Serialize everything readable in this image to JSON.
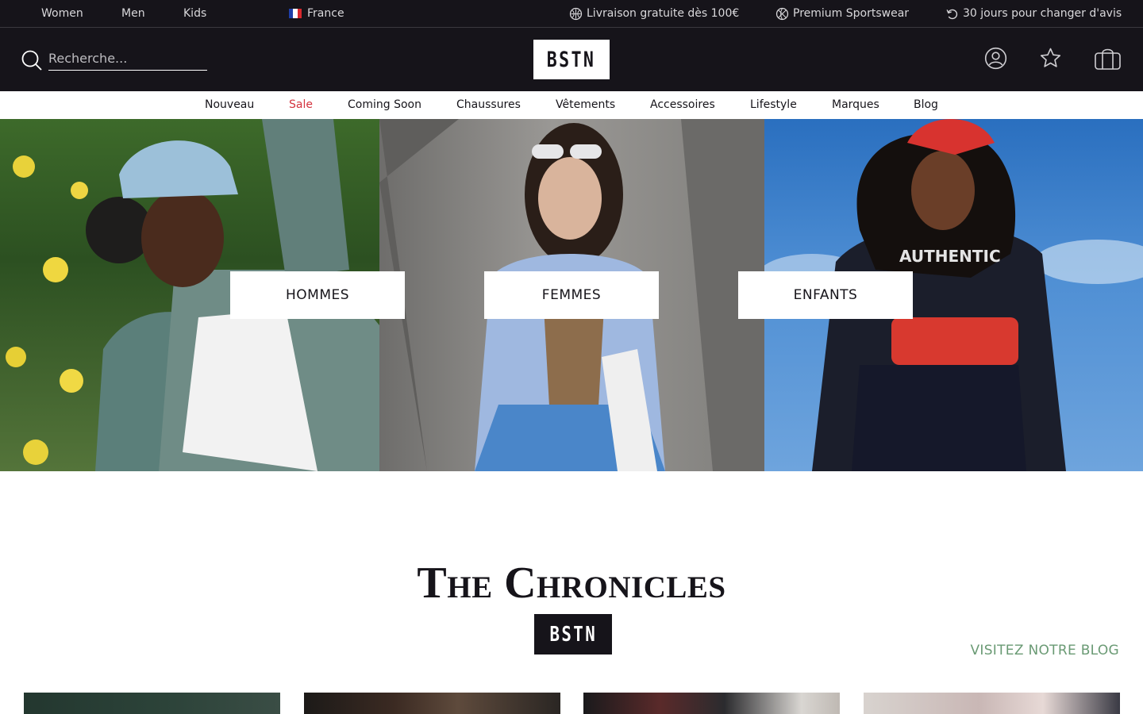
{
  "topbar": {
    "audience": [
      "Women",
      "Men",
      "Kids"
    ],
    "country": "France",
    "usps": [
      "Livraison gratuite dès 100€",
      "Premium Sportswear",
      "30 jours pour changer d'avis"
    ]
  },
  "header": {
    "search_placeholder": "Recherche...",
    "logo": "BSTN"
  },
  "nav": {
    "items": [
      "Nouveau",
      "Sale",
      "Coming Soon",
      "Chaussures",
      "Vêtements",
      "Accessoires",
      "Lifestyle",
      "Marques",
      "Blog"
    ]
  },
  "hero": {
    "categories": [
      "HOMMES",
      "FEMMES",
      "ENFANTS"
    ]
  },
  "chronicles": {
    "title": "The Chronicles",
    "logo": "BSTN",
    "blog_link": "VISITEZ NOTRE BLOG"
  },
  "colors": {
    "dark": "#16141a",
    "sale": "#d4343f",
    "blog_link": "#6a9a74"
  }
}
